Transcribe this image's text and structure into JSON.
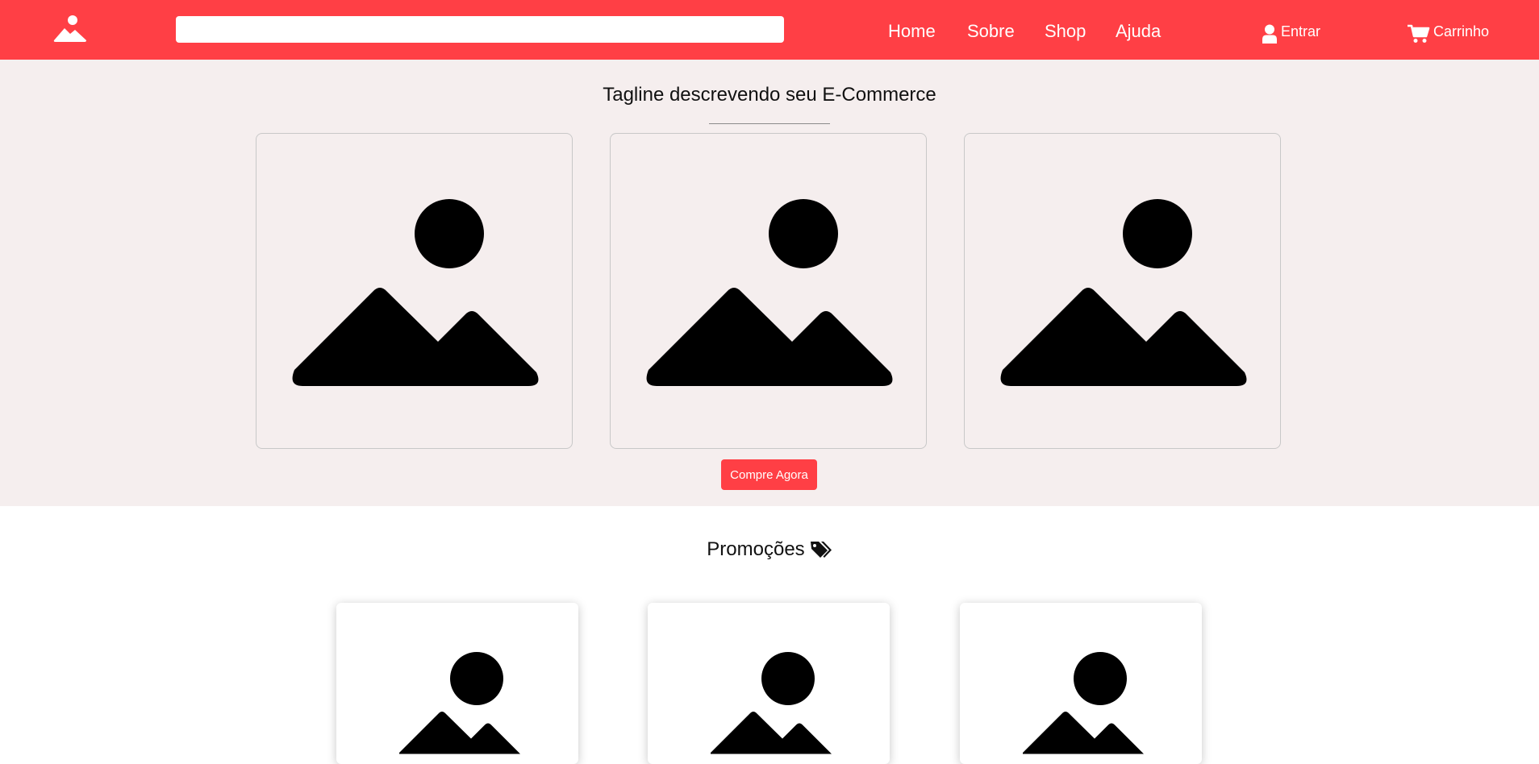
{
  "header": {
    "bg_color": "#ff3f45",
    "logo_icon": "landscape-image-icon",
    "search": {
      "value": "",
      "placeholder": ""
    },
    "nav": [
      {
        "label": "Home"
      },
      {
        "label": "Sobre"
      },
      {
        "label": "Shop"
      },
      {
        "label": "Ajuda"
      }
    ],
    "login": {
      "icon": "user-icon",
      "label": "Entrar"
    },
    "cart": {
      "icon": "shopping-cart-icon",
      "label": "Carrinho"
    }
  },
  "hero": {
    "bg_color": "#f5eeee",
    "tagline": "Tagline descrevendo seu E-Commerce",
    "cards": [
      {
        "icon": "image-placeholder-icon"
      },
      {
        "icon": "image-placeholder-icon"
      },
      {
        "icon": "image-placeholder-icon"
      }
    ],
    "button_label": "Compre Agora",
    "button_color": "#ff3f45"
  },
  "promotions": {
    "title": "Promoções",
    "title_icon": "tags-icon",
    "cards": [
      {
        "icon": "image-placeholder-icon"
      },
      {
        "icon": "image-placeholder-icon"
      },
      {
        "icon": "image-placeholder-icon"
      }
    ]
  }
}
